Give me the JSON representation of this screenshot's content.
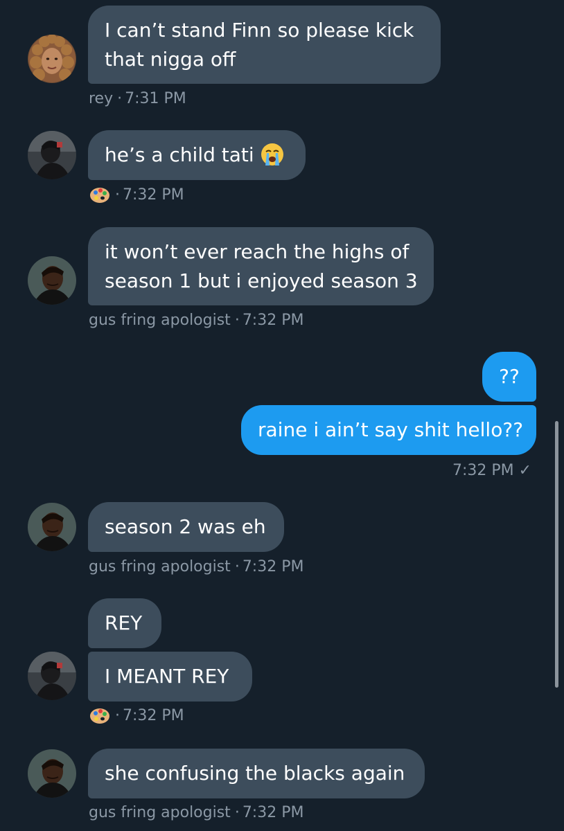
{
  "thread": {
    "messages": [
      {
        "id": "m1",
        "lines": [
          "I can’t stand Finn so please kick",
          "that nigga off"
        ]
      },
      {
        "id": "m2",
        "lines": [
          "he’s a child tati"
        ],
        "emoji": "loudly-crying-face"
      },
      {
        "id": "m3",
        "lines": [
          "it won’t ever reach the highs of",
          "season 1 but i enjoyed season 3"
        ]
      },
      {
        "id": "m4",
        "lines": [
          "??"
        ]
      },
      {
        "id": "m5",
        "lines": [
          "raine i ain’t say shit hello??"
        ]
      },
      {
        "id": "m6",
        "lines": [
          "season 2 was eh"
        ]
      },
      {
        "id": "m7",
        "lines": [
          "REY"
        ]
      },
      {
        "id": "m8",
        "lines": [
          "I MEANT REY"
        ]
      },
      {
        "id": "m9",
        "lines": [
          "she confusing the blacks again"
        ]
      }
    ],
    "meta": [
      {
        "id": "meta1",
        "sender": "rey",
        "separator": "·",
        "time": "7:31 PM"
      },
      {
        "id": "meta2",
        "sender_icon": "artist-palette-emoji",
        "separator": "·",
        "time": "7:32 PM"
      },
      {
        "id": "meta3",
        "sender": "gus fring apologist",
        "separator": "·",
        "time": "7:32 PM"
      },
      {
        "id": "meta4",
        "time": "7:32 PM",
        "status": "✓"
      },
      {
        "id": "meta5",
        "sender": "gus fring apologist",
        "separator": "·",
        "time": "7:32 PM"
      },
      {
        "id": "meta6",
        "sender_icon": "artist-palette-emoji",
        "separator": "·",
        "time": "7:32 PM"
      },
      {
        "id": "meta7",
        "sender": "gus fring apologist",
        "separator": "·",
        "time": "7:32 PM"
      }
    ]
  },
  "colors": {
    "background": "#15202b",
    "incoming_bubble": "#3d4d5c",
    "outgoing_bubble": "#1d9bf0",
    "meta_text": "#8b98a5",
    "message_text": "#ffffff"
  }
}
